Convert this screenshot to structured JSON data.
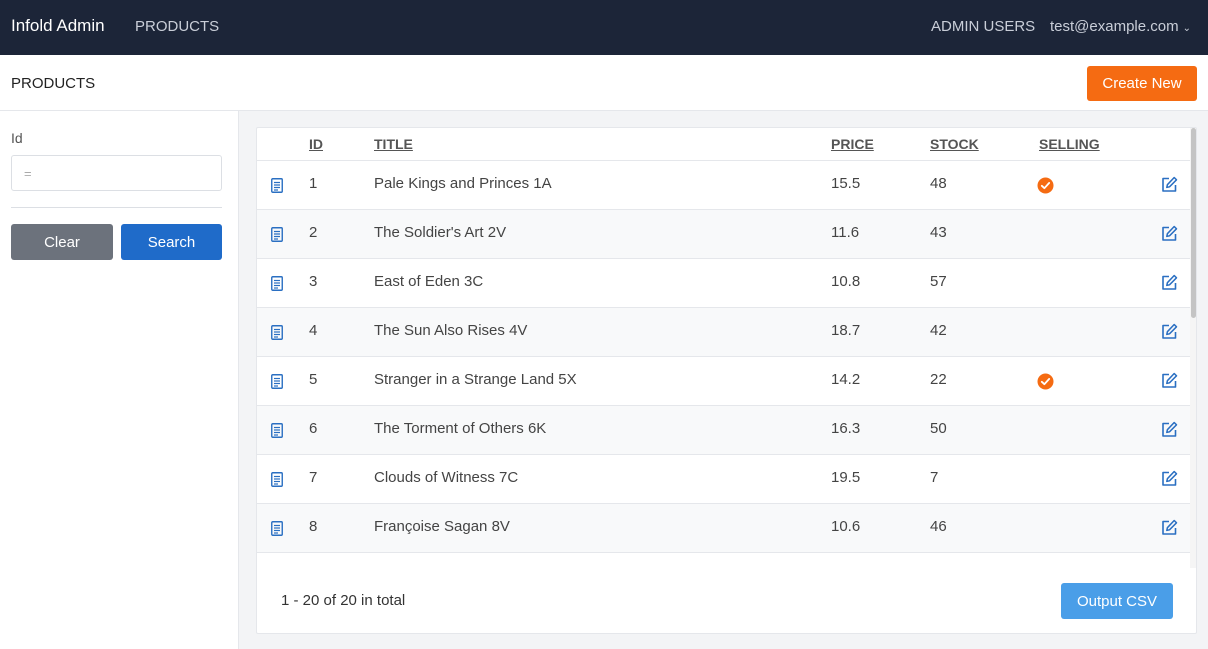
{
  "topbar": {
    "brand": "Infold Admin",
    "nav_products": "PRODUCTS",
    "nav_admin_users": "ADMIN USERS",
    "user_email": "test@example.com"
  },
  "header": {
    "title": "PRODUCTS",
    "create_label": "Create New"
  },
  "filter": {
    "id_label": "Id",
    "id_placeholder": "=",
    "clear_label": "Clear",
    "search_label": "Search"
  },
  "table": {
    "columns": [
      "ID",
      "TITLE",
      "PRICE",
      "STOCK",
      "SELLING"
    ],
    "rows": [
      {
        "id": "1",
        "title": "Pale Kings and Princes 1A",
        "price": "15.5",
        "stock": "48",
        "selling": true
      },
      {
        "id": "2",
        "title": "The Soldier's Art 2V",
        "price": "11.6",
        "stock": "43",
        "selling": false
      },
      {
        "id": "3",
        "title": "East of Eden 3C",
        "price": "10.8",
        "stock": "57",
        "selling": false
      },
      {
        "id": "4",
        "title": "The Sun Also Rises 4V",
        "price": "18.7",
        "stock": "42",
        "selling": false
      },
      {
        "id": "5",
        "title": "Stranger in a Strange Land 5X",
        "price": "14.2",
        "stock": "22",
        "selling": true
      },
      {
        "id": "6",
        "title": "The Torment of Others 6K",
        "price": "16.3",
        "stock": "50",
        "selling": false
      },
      {
        "id": "7",
        "title": "Clouds of Witness 7C",
        "price": "19.5",
        "stock": "7",
        "selling": false
      },
      {
        "id": "8",
        "title": "Françoise Sagan 8V",
        "price": "10.6",
        "stock": "46",
        "selling": false
      }
    ]
  },
  "footer": {
    "total_text": "1 - 20 of 20 in total",
    "csv_label": "Output CSV"
  },
  "colors": {
    "topbar": "#1c2538",
    "accent_orange": "#f56b12",
    "primary_blue": "#1f6bc9",
    "icon_blue": "#2a6fc2",
    "csv_blue": "#4a9ee8"
  }
}
